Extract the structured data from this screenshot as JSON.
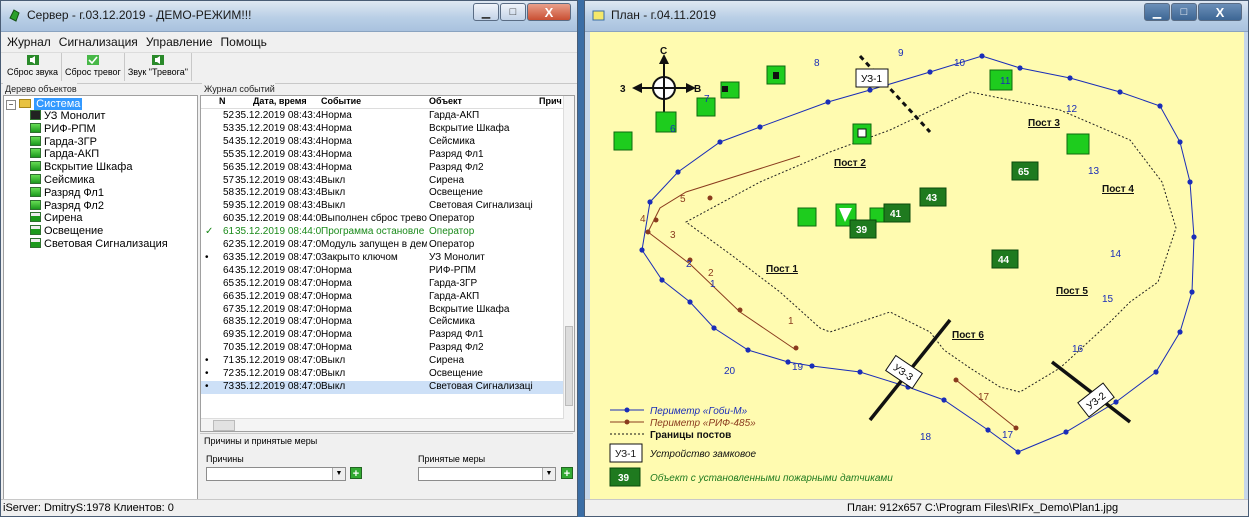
{
  "server": {
    "title": "Сервер - г.03.12.2019 - ДЕМО-РЕЖИМ!!!",
    "menu": [
      "Журнал",
      "Сигнализация",
      "Управление",
      "Помощь"
    ],
    "toolbar": [
      "Сброс звука",
      "Сброс тревог",
      "Звук \"Тревога\""
    ],
    "tree_title": "Дерево объектов",
    "tree_root": "Система",
    "tree_items": [
      "УЗ Монолит",
      "РИФ-РПМ",
      "Гарда-3ГР",
      "Гарда-АКП",
      "Вскрытие Шкафа",
      "Сейсмика",
      "Разряд Фл1",
      "Разряд Фл2",
      "Сирена",
      "Освещение",
      "Световая Сигнализация"
    ],
    "journal_title": "Журнал событий",
    "journal_columns": [
      "N",
      "Дата, время",
      "Событие",
      "Объект",
      "Прич"
    ],
    "journal_rows": [
      {
        "n": "52",
        "dt": "35.12.2019  08:43:4(",
        "event": "Норма",
        "object": "Гарда-АКП"
      },
      {
        "n": "53",
        "dt": "35.12.2019  08:43:4(",
        "event": "Норма",
        "object": "Вскрытие Шкафа"
      },
      {
        "n": "54",
        "dt": "35.12.2019  08:43:4(",
        "event": "Норма",
        "object": "Сейсмика"
      },
      {
        "n": "55",
        "dt": "35.12.2019  08:43:4(",
        "event": "Норма",
        "object": "Разряд Фл1"
      },
      {
        "n": "56",
        "dt": "35.12.2019  08:43:4(",
        "event": "Норма",
        "object": "Разряд Фл2"
      },
      {
        "n": "57",
        "dt": "35.12.2019  08:43:4(",
        "event": "Выкл",
        "object": "Сирена"
      },
      {
        "n": "58",
        "dt": "35.12.2019  08:43:4(",
        "event": "Выкл",
        "object": "Освещение"
      },
      {
        "n": "59",
        "dt": "35.12.2019  08:43:4(",
        "event": "Выкл",
        "object": "Световая Сигнализаці"
      },
      {
        "n": "60",
        "dt": "35.12.2019  08:44:0",
        "event": "Выполнен сброс трево",
        "object": "Оператор"
      },
      {
        "n": "61",
        "dt": "35.12.2019  08:44:0(",
        "event": "Программа остановле",
        "object": "Оператор"
      },
      {
        "n": "62",
        "dt": "35.12.2019  08:47:0(",
        "event": "Модуль запущен в дем",
        "object": "Оператор"
      },
      {
        "n": "63",
        "dt": "35.12.2019  08:47:0(",
        "event": "Закрыто ключом",
        "object": "УЗ Монолит"
      },
      {
        "n": "64",
        "dt": "35.12.2019  08:47:0(",
        "event": "Норма",
        "object": "РИФ-РПМ"
      },
      {
        "n": "65",
        "dt": "35.12.2019  08:47:0(",
        "event": "Норма",
        "object": "Гарда-3ГР"
      },
      {
        "n": "66",
        "dt": "35.12.2019  08:47:0(",
        "event": "Норма",
        "object": "Гарда-АКП"
      },
      {
        "n": "67",
        "dt": "35.12.2019  08:47:0(",
        "event": "Норма",
        "object": "Вскрытие Шкафа"
      },
      {
        "n": "68",
        "dt": "35.12.2019  08:47:0(",
        "event": "Норма",
        "object": "Сейсмика"
      },
      {
        "n": "69",
        "dt": "35.12.2019  08:47:0(",
        "event": "Норма",
        "object": "Разряд Фл1"
      },
      {
        "n": "70",
        "dt": "35.12.2019  08:47:0(",
        "event": "Норма",
        "object": "Разряд Фл2"
      },
      {
        "n": "71",
        "dt": "35.12.2019  08:47:0(",
        "event": "Выкл",
        "object": "Сирена"
      },
      {
        "n": "72",
        "dt": "35.12.2019  08:47:0(",
        "event": "Выкл",
        "object": "Освещение"
      },
      {
        "n": "73",
        "dt": "35.12.2019  08:47:0(",
        "event": "Выкл",
        "object": "Световая Сигнализаці"
      }
    ],
    "causes_title": "Причины и принятые меры",
    "causes_label": "Причины",
    "measures_label": "Принятые меры",
    "status": "iServer: DmitryS:1978 Клиентов: 0"
  },
  "plan": {
    "title": "План - г.04.11.2019",
    "compass": {
      "n": "С",
      "w": "3",
      "e": "В"
    },
    "posts": [
      "Пост 1",
      "Пост 2",
      "Пост 3",
      "Пост 4",
      "Пост 5",
      "Пост 6"
    ],
    "locks": [
      "УЗ-1",
      "УЗ-3",
      "УЗ-2"
    ],
    "fire_objects": [
      "65",
      "43",
      "44",
      "41",
      "39"
    ],
    "blue_numbers": [
      "1",
      "2",
      "3",
      "4",
      "5",
      "6",
      "7",
      "8",
      "9",
      "10",
      "11",
      "12",
      "13",
      "14",
      "15",
      "16",
      "17",
      "18",
      "19",
      "20"
    ],
    "brown_numbers": [
      "1",
      "2",
      "3",
      "4",
      "5",
      "17"
    ],
    "legend": [
      "Периметр «Гоби-М»",
      "Периметр «РИФ-485»",
      "Границы постов",
      "Устройство замковое",
      "Объект с установленными пожарными датчиками"
    ],
    "legend_lock": "УЗ-1",
    "legend_fire": "39",
    "status": "План: 912x657 C:\\Program Files\\RIFx_Demo\\Plan1.jpg",
    "colors": {
      "map_bg": "#fffbb0",
      "perimeter": "#1a2db8",
      "rif": "#8a3b1e",
      "fire": "#1f7a1f",
      "device": "#1ecc1e"
    }
  }
}
